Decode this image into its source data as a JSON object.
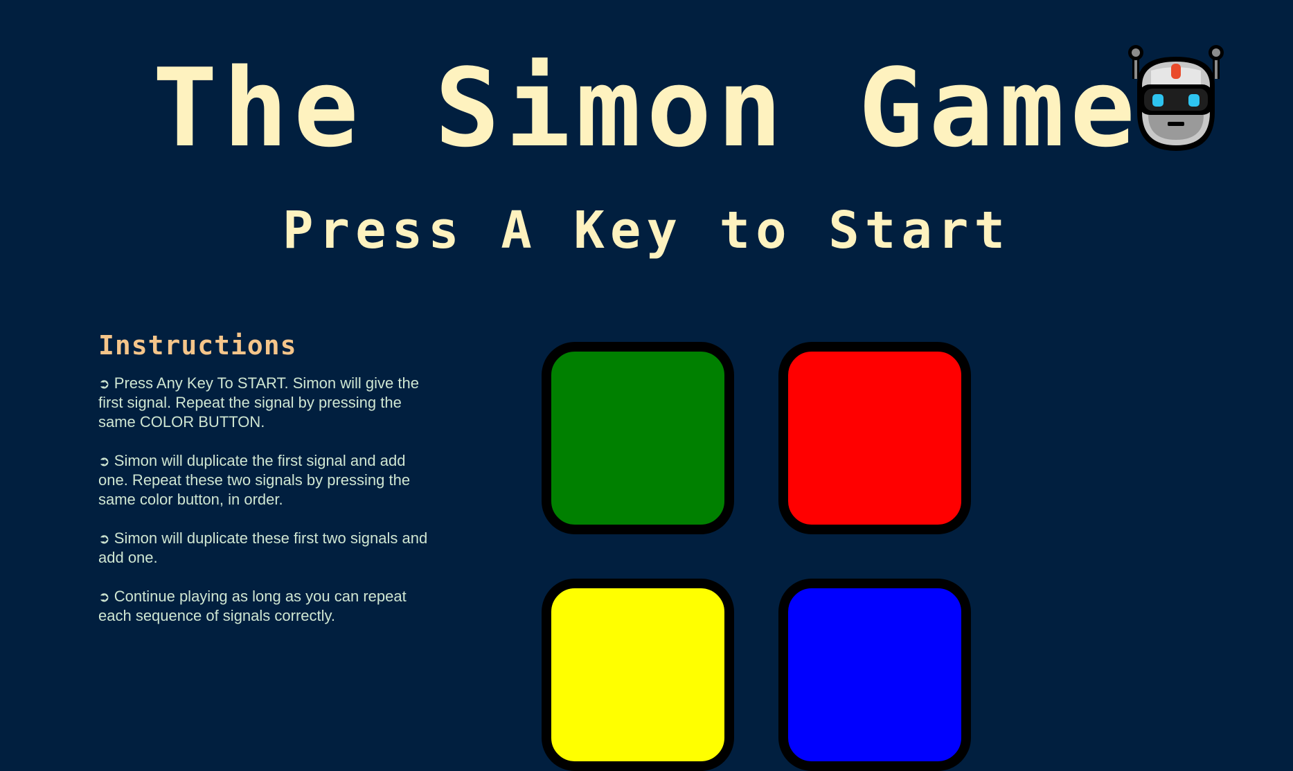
{
  "header": {
    "title": "The Simon Game",
    "robot_icon": "robot-icon"
  },
  "status": {
    "level_title": "Press A Key to Start"
  },
  "instructions": {
    "heading": "Instructions",
    "bullet": "➲",
    "items": [
      "Press Any Key To START. Simon will give the first signal. Repeat the signal by pressing the same COLOR BUTTON.",
      "Simon will duplicate the first signal and add one. Repeat these two signals by pressing the same color button, in order.",
      "Simon will duplicate these first two signals and add one.",
      "Continue playing as long as you can repeat each sequence of signals correctly."
    ]
  },
  "buttons": [
    {
      "id": "green",
      "color": "#008000"
    },
    {
      "id": "red",
      "color": "#FF0000"
    },
    {
      "id": "yellow",
      "color": "#FFFF00"
    },
    {
      "id": "blue",
      "color": "#0000FF"
    }
  ],
  "colors": {
    "background": "#011F3F",
    "title": "#FEF2BF",
    "heading": "#F5C58A",
    "body_text": "#CFE6D2"
  }
}
